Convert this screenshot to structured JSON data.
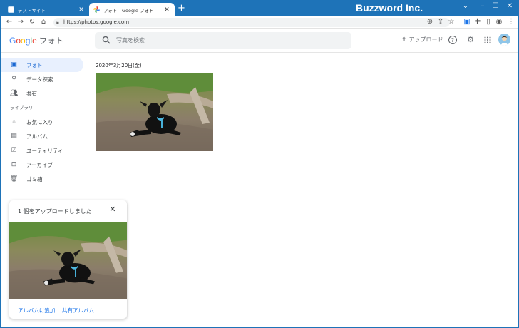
{
  "browser": {
    "tabs": [
      {
        "label": "テストサイト",
        "active": false
      },
      {
        "label": "フォト - Google フォト",
        "active": true
      }
    ],
    "brand": "Buzzword Inc.",
    "url": "https://photos.google.com"
  },
  "header": {
    "logo_google": [
      "G",
      "o",
      "o",
      "g",
      "l",
      "e"
    ],
    "product": "フォト",
    "search_placeholder": "写真を検索",
    "upload_label": "アップロード"
  },
  "sidebar": {
    "items": [
      {
        "label": "フォト",
        "icon": "photo-icon",
        "active": true
      },
      {
        "label": "データ探索",
        "icon": "search-icon",
        "active": false
      },
      {
        "label": "共有",
        "icon": "people-icon",
        "active": false
      }
    ],
    "section_label": "ライブラリ",
    "library_items": [
      {
        "label": "お気に入り",
        "icon": "star-icon"
      },
      {
        "label": "アルバム",
        "icon": "album-icon"
      },
      {
        "label": "ユーティリティ",
        "icon": "utility-icon"
      },
      {
        "label": "アーカイブ",
        "icon": "archive-icon"
      },
      {
        "label": "ゴミ箱",
        "icon": "trash-icon"
      }
    ]
  },
  "main": {
    "date_heading": "2020年3月20日(金)"
  },
  "toast": {
    "title": "1 個をアップロードしました",
    "add_to_album": "アルバムに追加",
    "shared_album": "共有アルバム"
  },
  "colors": {
    "title_bar": "#1e73b8",
    "accent": "#1a73e8",
    "active_nav_bg": "#e8f0fe"
  }
}
